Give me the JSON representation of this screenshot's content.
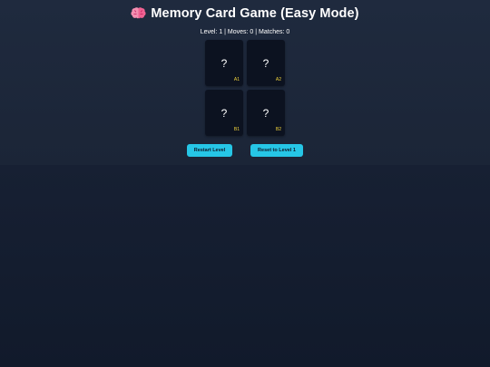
{
  "game": {
    "title": "Memory Card Game (Easy Mode)",
    "title_icon": "brain-icon",
    "stats": "Level: 1 | Moves: 0 | Matches: 0"
  },
  "cards": [
    {
      "symbol": "?",
      "label": "A1",
      "face": "down"
    },
    {
      "symbol": "?",
      "label": "A2",
      "face": "down"
    },
    {
      "symbol": "?",
      "label": "B1",
      "face": "down"
    },
    {
      "symbol": "?",
      "label": "B2",
      "face": "down"
    }
  ],
  "controls": {
    "restart_label": "Restart Level",
    "reset_label": "Reset to Level 1"
  },
  "colors": {
    "accent": "#26c6e6",
    "card_back": "#0c1220",
    "card_label": "#f5d63a",
    "background": "#172033"
  }
}
